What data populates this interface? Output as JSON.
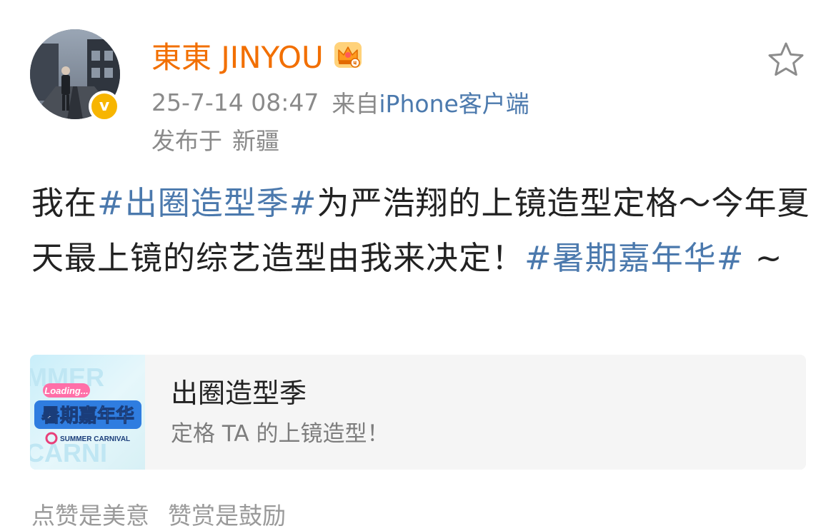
{
  "author": {
    "name": "東東 JINYOU",
    "avatar_icon": "avatar-photo",
    "verified_icon": "verified-v-icon",
    "verified_letter": "v",
    "member_icon": "crown-icon",
    "name_color": "#f26f00"
  },
  "meta": {
    "timestamp": "25-7-14 08:47",
    "source_prefix": "来自",
    "source": "iPhone客户端",
    "location_prefix": "发布于",
    "location": "新疆"
  },
  "post": {
    "segments": [
      {
        "text": "我在",
        "type": "text"
      },
      {
        "text": "#出圈造型季#",
        "type": "hashtag"
      },
      {
        "text": "为严浩翔的上镜造型定格～今年夏天最上镜的综艺造型由我来决定！",
        "type": "text"
      },
      {
        "text": "#暑期嘉年华#",
        "type": "hashtag"
      },
      {
        "text": " ~",
        "type": "text"
      }
    ],
    "hashtag_color": "#4b79ad"
  },
  "topic_card": {
    "title": "出圈造型季",
    "subtitle": "定格 TA 的上镜造型！",
    "thumbnail_icon": "summer-carnival-logo",
    "thumbnail_text": {
      "badge": "Loading...",
      "main": "暑期嘉年华",
      "english": "SUMMER CARNIVAL"
    }
  },
  "footer": {
    "left": "点赞是美意",
    "right": "赞赏是鼓励"
  },
  "actions": {
    "favorite_icon": "star-outline-icon"
  }
}
